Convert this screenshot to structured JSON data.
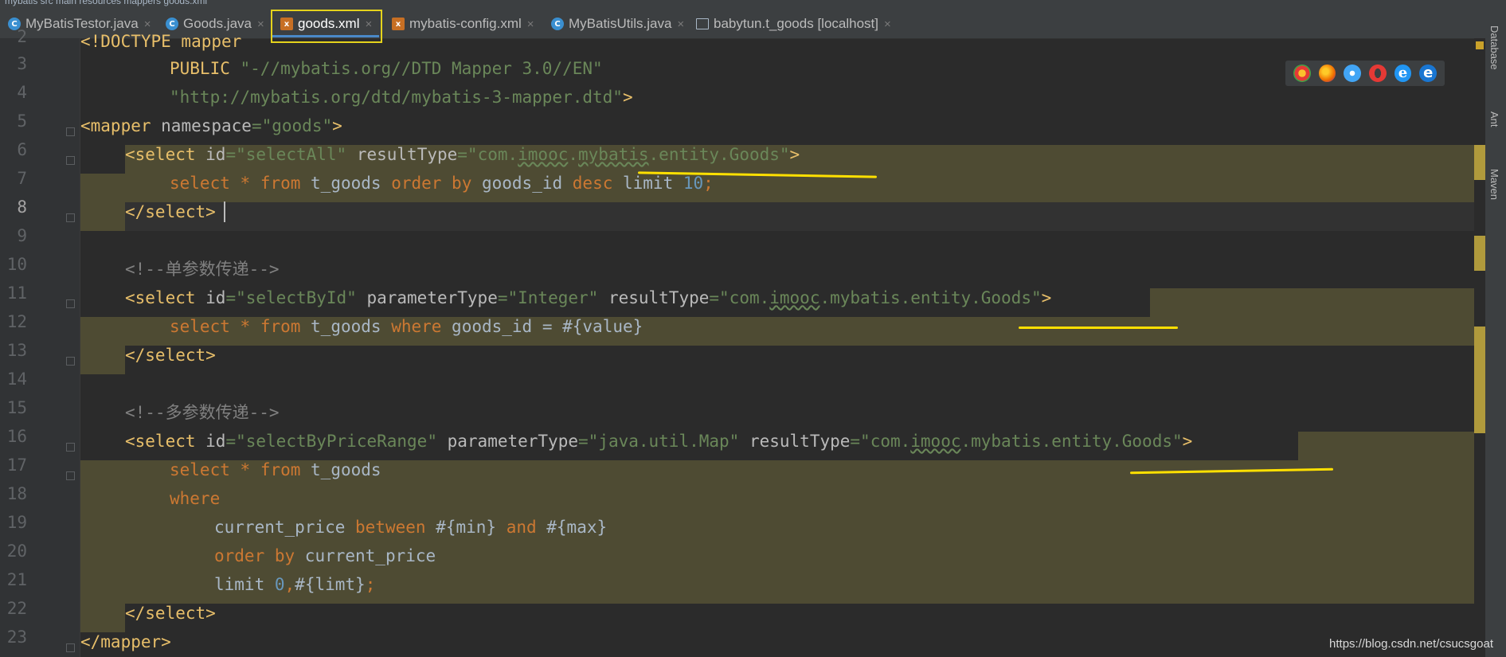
{
  "breadcrumb": "mybatis  src  main  resources  mappers  goods.xml",
  "tabs": [
    {
      "label": "MyBatisTestor.java",
      "icon": "java-class-icon"
    },
    {
      "label": "Goods.java",
      "icon": "java-class-icon"
    },
    {
      "label": "goods.xml",
      "icon": "xml-file-icon"
    },
    {
      "label": "mybatis-config.xml",
      "icon": "xml-file-icon"
    },
    {
      "label": "MyBatisUtils.java",
      "icon": "java-class-icon"
    },
    {
      "label": "babytun.t_goods [localhost]",
      "icon": "table-icon"
    }
  ],
  "close_glyph": "×",
  "line_numbers": [
    "2",
    "3",
    "4",
    "5",
    "6",
    "7",
    "8",
    "9",
    "10",
    "11",
    "12",
    "13",
    "14",
    "15",
    "16",
    "17",
    "18",
    "19",
    "20",
    "21",
    "22",
    "23"
  ],
  "code": {
    "l2": {
      "a": "<!DOCTYPE mapper"
    },
    "l3": {
      "a": "PUBLIC ",
      "b": "\"-//mybatis.org//DTD Mapper 3.0//EN\""
    },
    "l4": {
      "a": "\"http://mybatis.org/dtd/mybatis-3-mapper.dtd\"",
      "b": ">"
    },
    "l5": {
      "a": "<mapper ",
      "b": "namespace",
      "c": "=",
      "d": "\"goods\"",
      "e": ">"
    },
    "l6": {
      "a": "<select ",
      "b": "id",
      "c": "=",
      "d": "\"selectAll\"",
      "e": " resultType",
      "f": "=",
      "g": "\"com.",
      "h": "imooc",
      "i": ".",
      "j": "mybatis",
      "k": ".entity.Goods\"",
      "l": ">"
    },
    "l7": {
      "a": "select ",
      "b": "* ",
      "c": "from ",
      "d": "t_goods ",
      "e": "order by ",
      "f": "goods_id ",
      "g": "desc ",
      "h": "limit ",
      "i": "10",
      "j": ";"
    },
    "l8": {
      "a": "</select>"
    },
    "l10": {
      "a": "<!--单参数传递-->"
    },
    "l11": {
      "a": "<select ",
      "b": "id",
      "c": "=",
      "d": "\"selectById\"",
      "e": " parameterType",
      "f": "=",
      "g": "\"Integer\"",
      "h": " resultType",
      "i": "=",
      "j": "\"com.",
      "k": "imooc",
      "l": ".mybatis.entity.Goods\"",
      "m": ">"
    },
    "l12": {
      "a": "select ",
      "b": "* ",
      "c": "from ",
      "d": "t_goods ",
      "e": "where ",
      "f": "goods_id = #{value}"
    },
    "l13": {
      "a": "</select>"
    },
    "l15": {
      "a": "<!--多参数传递-->"
    },
    "l16": {
      "a": "<select ",
      "b": "id",
      "c": "=",
      "d": "\"selectByPriceRange\"",
      "e": " parameterType",
      "f": "=",
      "g": "\"java.util.Map\"",
      "h": " resultType",
      "i": "=",
      "j": "\"com.",
      "k": "imooc",
      "l": ".mybatis.entity.Goods\"",
      "m": ">"
    },
    "l17": {
      "a": "select ",
      "b": "* ",
      "c": "from ",
      "d": "t_goods"
    },
    "l18": {
      "a": "where"
    },
    "l19": {
      "a": "current_price ",
      "b": "between ",
      "c": "#{min} ",
      "d": "and ",
      "e": "#{max}"
    },
    "l20": {
      "a": "order by ",
      "b": "current_price"
    },
    "l21": {
      "a": "limit ",
      "b": "0",
      "c": ",",
      "d": "#{limt}",
      "e": ";"
    },
    "l22": {
      "a": "</select>"
    },
    "l23": {
      "a": "</mapper>"
    }
  },
  "right_panel": {
    "database": "Database",
    "ant": "Ant",
    "maven": "Maven"
  },
  "browsers": [
    "chrome-icon",
    "firefox-icon",
    "safari-icon",
    "opera-icon",
    "ie-icon",
    "edge-icon"
  ],
  "watermark": "https://blog.csdn.net/csucsgoat",
  "colors": {
    "tag": "#e8bf6a",
    "attr_value": "#6a8759",
    "keyword": "#cc7832",
    "number": "#6897bb",
    "highlight_bg": "#4e4b33",
    "annotation": "#ffe000"
  }
}
